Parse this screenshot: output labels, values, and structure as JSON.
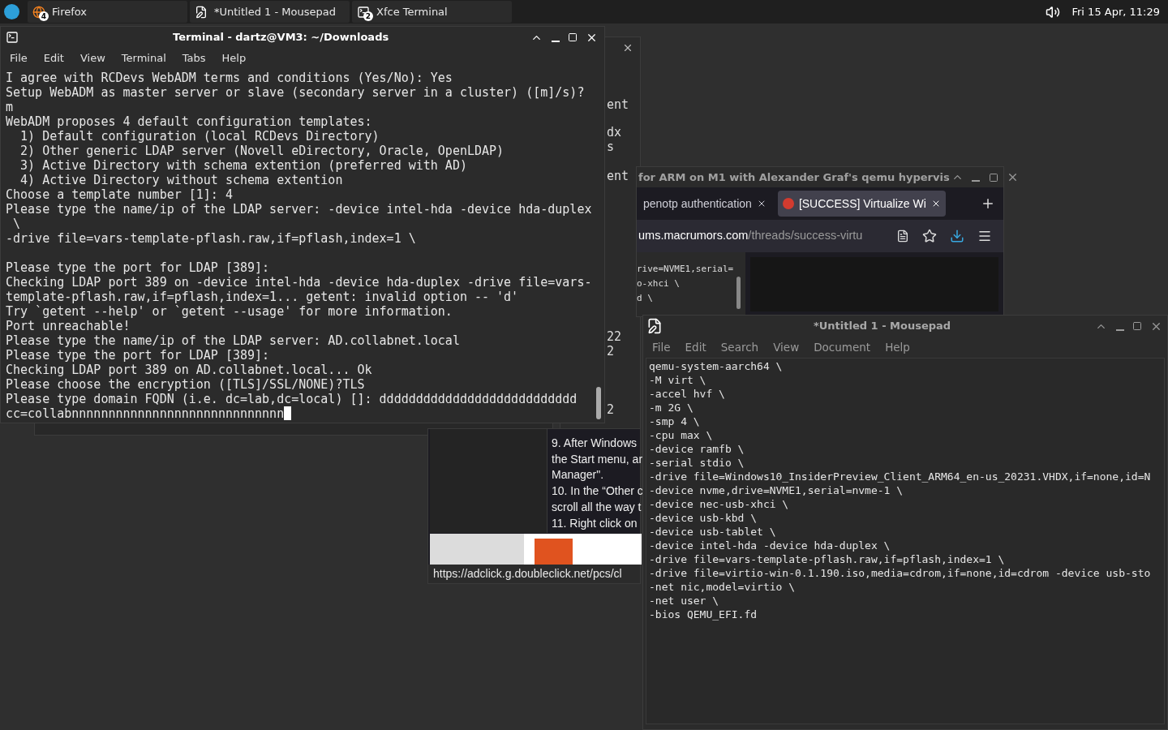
{
  "panel": {
    "tasks": [
      {
        "label": "Firefox",
        "count": "4",
        "kind": "browser"
      },
      {
        "label": "*Untitled 1 - Mousepad",
        "kind": "editor"
      },
      {
        "label": "Xfce Terminal",
        "count": "2",
        "kind": "terminal"
      }
    ],
    "clock": "Fri 15 Apr, 11:29"
  },
  "back_window": {
    "blocks": [
      [
        "ent"
      ],
      [
        "dx",
        "s"
      ],
      [
        "ent"
      ],
      [
        "22",
        "2"
      ],
      [
        "2"
      ]
    ]
  },
  "browser_fragment": {
    "article": [
      "9. After Windows",
      "the Start menu, ar",
      "Manager\".",
      "10. In the “Other c",
      "scroll all the way t",
      "11. Right click on"
    ],
    "status_url": "https://adclick.g.doubleclick.net/pcs/cl"
  },
  "browser": {
    "title": "for ARM on M1 with Alexander Graf's qemu hypervis",
    "tabs": [
      {
        "label": "penotp authentication",
        "selected": false
      },
      {
        "label": "[SUCCESS] Virtualize Wi",
        "selected": true
      }
    ],
    "url_host": "ums.macrumors.com",
    "url_path": "/threads/success-virtu",
    "code_lines": [
      "rive=NVME1,serial=",
      "o-xhci \\",
      "d \\"
    ]
  },
  "terminal": {
    "title": "Terminal - dartz@VM3: ~/Downloads",
    "menu": [
      "File",
      "Edit",
      "View",
      "Terminal",
      "Tabs",
      "Help"
    ],
    "output": [
      [
        "I agree with RCDevs WebADM terms and conditions (Yes/No): Yes",
        "Setup WebADM as master server or slave (secondary server in a cluster) ([m]/s)?",
        "m",
        "WebADM proposes 4 default configuration templates:",
        "  1) Default configuration (local RCDevs Directory)",
        "  2) Other generic LDAP server (Novell eDirectory, Oracle, OpenLDAP)",
        "  3) Active Directory with schema extention (preferred with AD)",
        "  4) Active Directory without schema extention",
        "Choose a template number [1]: 4",
        "Please type the name/ip of the LDAP server: -device intel-hda -device hda-duplex",
        " \\",
        "-drive file=vars-template-pflash.raw,if=pflash,index=1 \\"
      ],
      [
        "Please type the port for LDAP [389]:",
        "Checking LDAP port 389 on -device intel-hda -device hda-duplex -drive file=vars-",
        "template-pflash.raw,if=pflash,index=1... getent: invalid option -- 'd'",
        "Try `getent --help' or `getent --usage' for more information.",
        "Port unreachable!",
        "Please type the name/ip of the LDAP server: AD.collabnet.local",
        "Please type the port for LDAP [389]:",
        "Checking LDAP port 389 on AD.collabnet.local... Ok",
        "Please choose the encryption ([TLS]/SSL/NONE)?TLS",
        "Please type domain FQDN (i.e. dc=lab,dc=local) []: ddddddddddddddddddddddddddd",
        "cc=collabnnnnnnnnnnnnnnnnnnnnnnnnnnnnn"
      ]
    ]
  },
  "mousepad": {
    "title": "*Untitled 1 - Mousepad",
    "menu": [
      "File",
      "Edit",
      "Search",
      "View",
      "Document",
      "Help"
    ],
    "lines": [
      "qemu-system-aarch64 \\",
      "-M virt \\",
      "-accel hvf \\",
      "-m 2G \\",
      "-smp 4 \\",
      "-cpu max \\",
      "-device ramfb \\",
      "-serial stdio \\",
      "-drive file=Windows10_InsiderPreview_Client_ARM64_en-us_20231.VHDX,if=none,id=N",
      "-device nvme,drive=NVME1,serial=nvme-1 \\",
      "-device nec-usb-xhci \\",
      "-device usb-kbd \\",
      "-device usb-tablet \\",
      "-device intel-hda -device hda-duplex \\",
      "-drive file=vars-template-pflash.raw,if=pflash,index=1 \\",
      "-drive file=virtio-win-0.1.190.iso,media=cdrom,if=none,id=cdrom -device usb-sto",
      "-net nic,model=virtio \\",
      "-net user \\",
      "-bios QEMU_EFI.fd"
    ]
  }
}
